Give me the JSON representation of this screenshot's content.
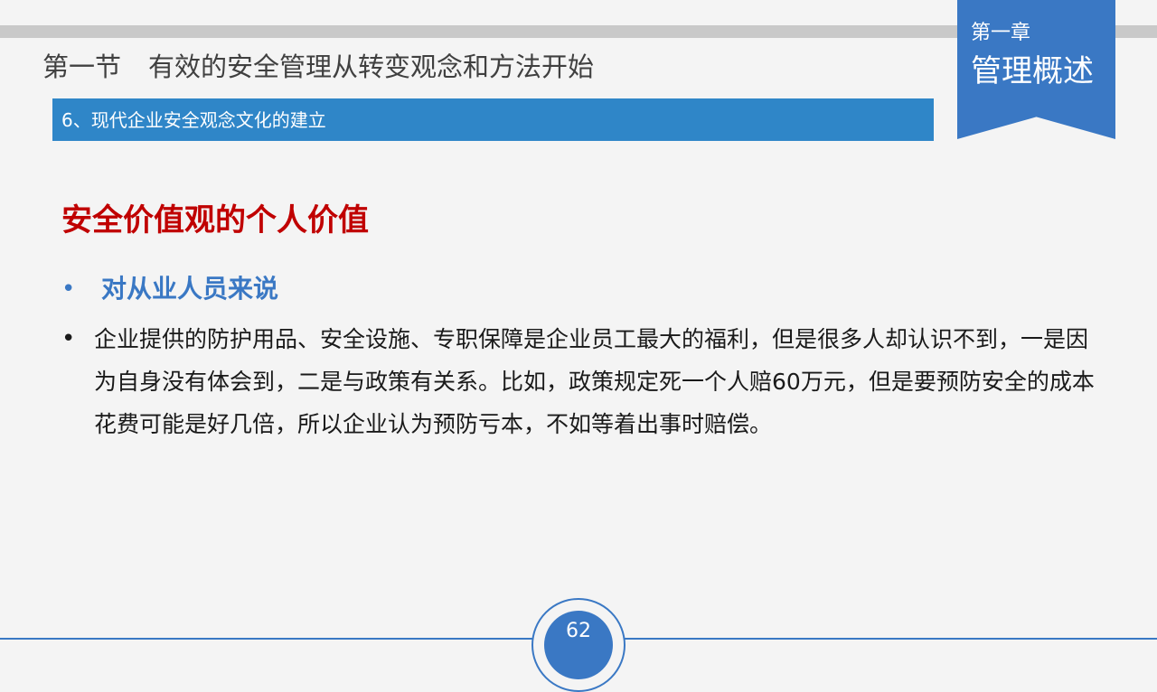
{
  "chapter": {
    "number": "第一章",
    "title": "管理概述"
  },
  "section": {
    "label": "第一节",
    "title": "有效的安全管理从转变观念和方法开始"
  },
  "subsection": {
    "title": "6、现代企业安全观念文化的建立"
  },
  "heading": "安全价值观的个人价值",
  "bullets": [
    {
      "marker": "•",
      "text": "对从业人员来说"
    },
    {
      "marker": "•",
      "text": "企业提供的防护用品、安全设施、专职保障是企业员工最大的福利，但是很多人却认识不到，一是因为自身没有体会到，二是与政策有关系。比如，政策规定死一个人赔60万元，但是要预防安全的成本花费可能是好几倍，所以企业认为预防亏本，不如等着出事时赔偿。"
    }
  ],
  "page_number": "62",
  "colors": {
    "accent_blue": "#3a78c4",
    "subsection_blue": "#2f86c8",
    "heading_red": "#c00000",
    "top_bar_gray": "#c9c9c9",
    "background": "#f4f4f4"
  }
}
